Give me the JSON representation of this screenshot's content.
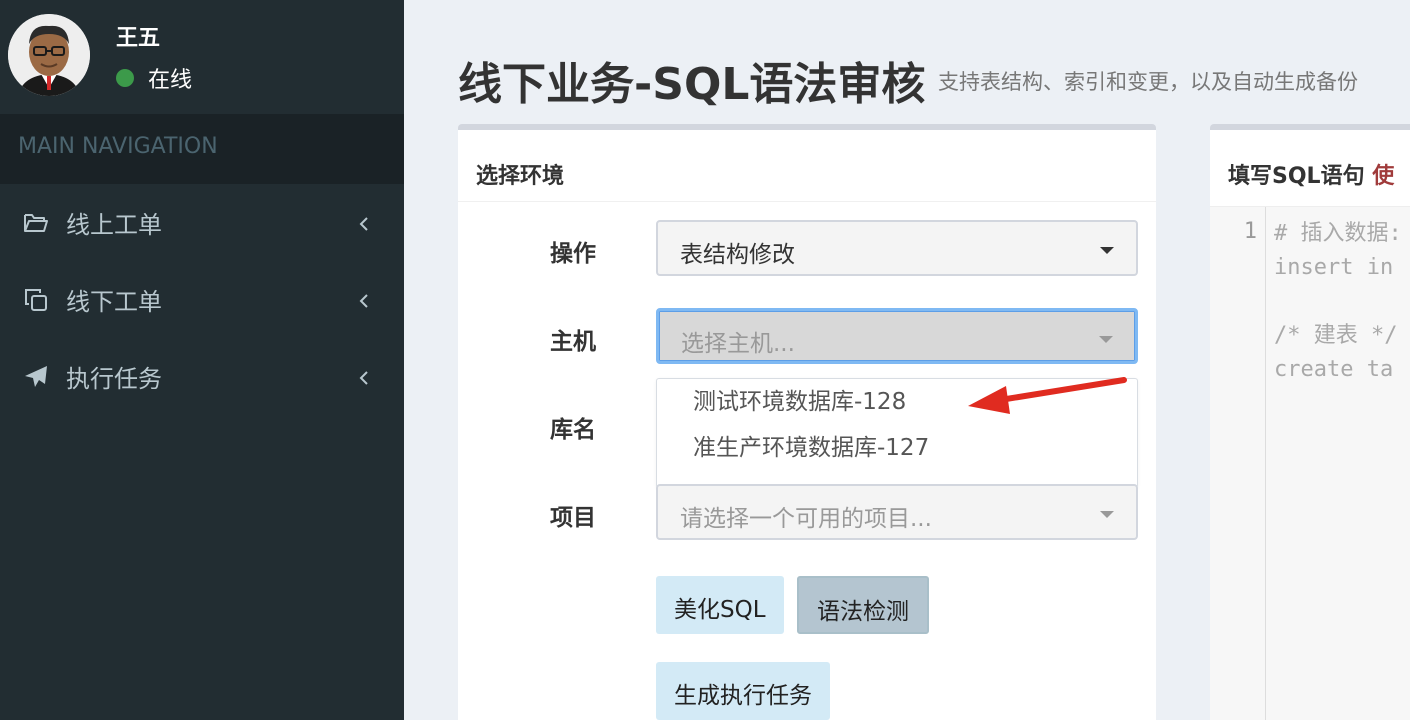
{
  "user": {
    "name": "王五",
    "status": "在线"
  },
  "sidebar": {
    "header": "MAIN NAVIGATION",
    "items": [
      {
        "label": "线上工单",
        "icon": "folder-open-icon"
      },
      {
        "label": "线下工单",
        "icon": "copy-icon"
      },
      {
        "label": "执行任务",
        "icon": "paper-plane-icon"
      }
    ]
  },
  "page": {
    "title": "线下业务-SQL语法审核",
    "subtitle": "支持表结构、索引和变更，以及自动生成备份"
  },
  "form_box": {
    "title": "选择环境",
    "fields": {
      "operation": {
        "label": "操作",
        "value": "表结构修改"
      },
      "host": {
        "label": "主机",
        "placeholder": "选择主机..."
      },
      "database": {
        "label": "库名"
      },
      "project": {
        "label": "项目",
        "placeholder": "请选择一个可用的项目..."
      }
    },
    "host_options": [
      "测试环境数据库-128",
      "准生产环境数据库-127"
    ],
    "buttons": {
      "beautify": "美化SQL",
      "syntax_check": "语法检测",
      "generate_task": "生成执行任务"
    }
  },
  "sql_box": {
    "title": "填写SQL语句",
    "title_hint": "使",
    "line_number": "1",
    "code_lines": [
      "# 插入数据:",
      "insert in",
      "",
      "/* 建表 */",
      "create ta"
    ]
  },
  "colors": {
    "sidebar_bg": "#222d32",
    "online_green": "#3c9a4a",
    "annotation_arrow": "#e02b20",
    "focus_border": "#7fb9f3"
  }
}
